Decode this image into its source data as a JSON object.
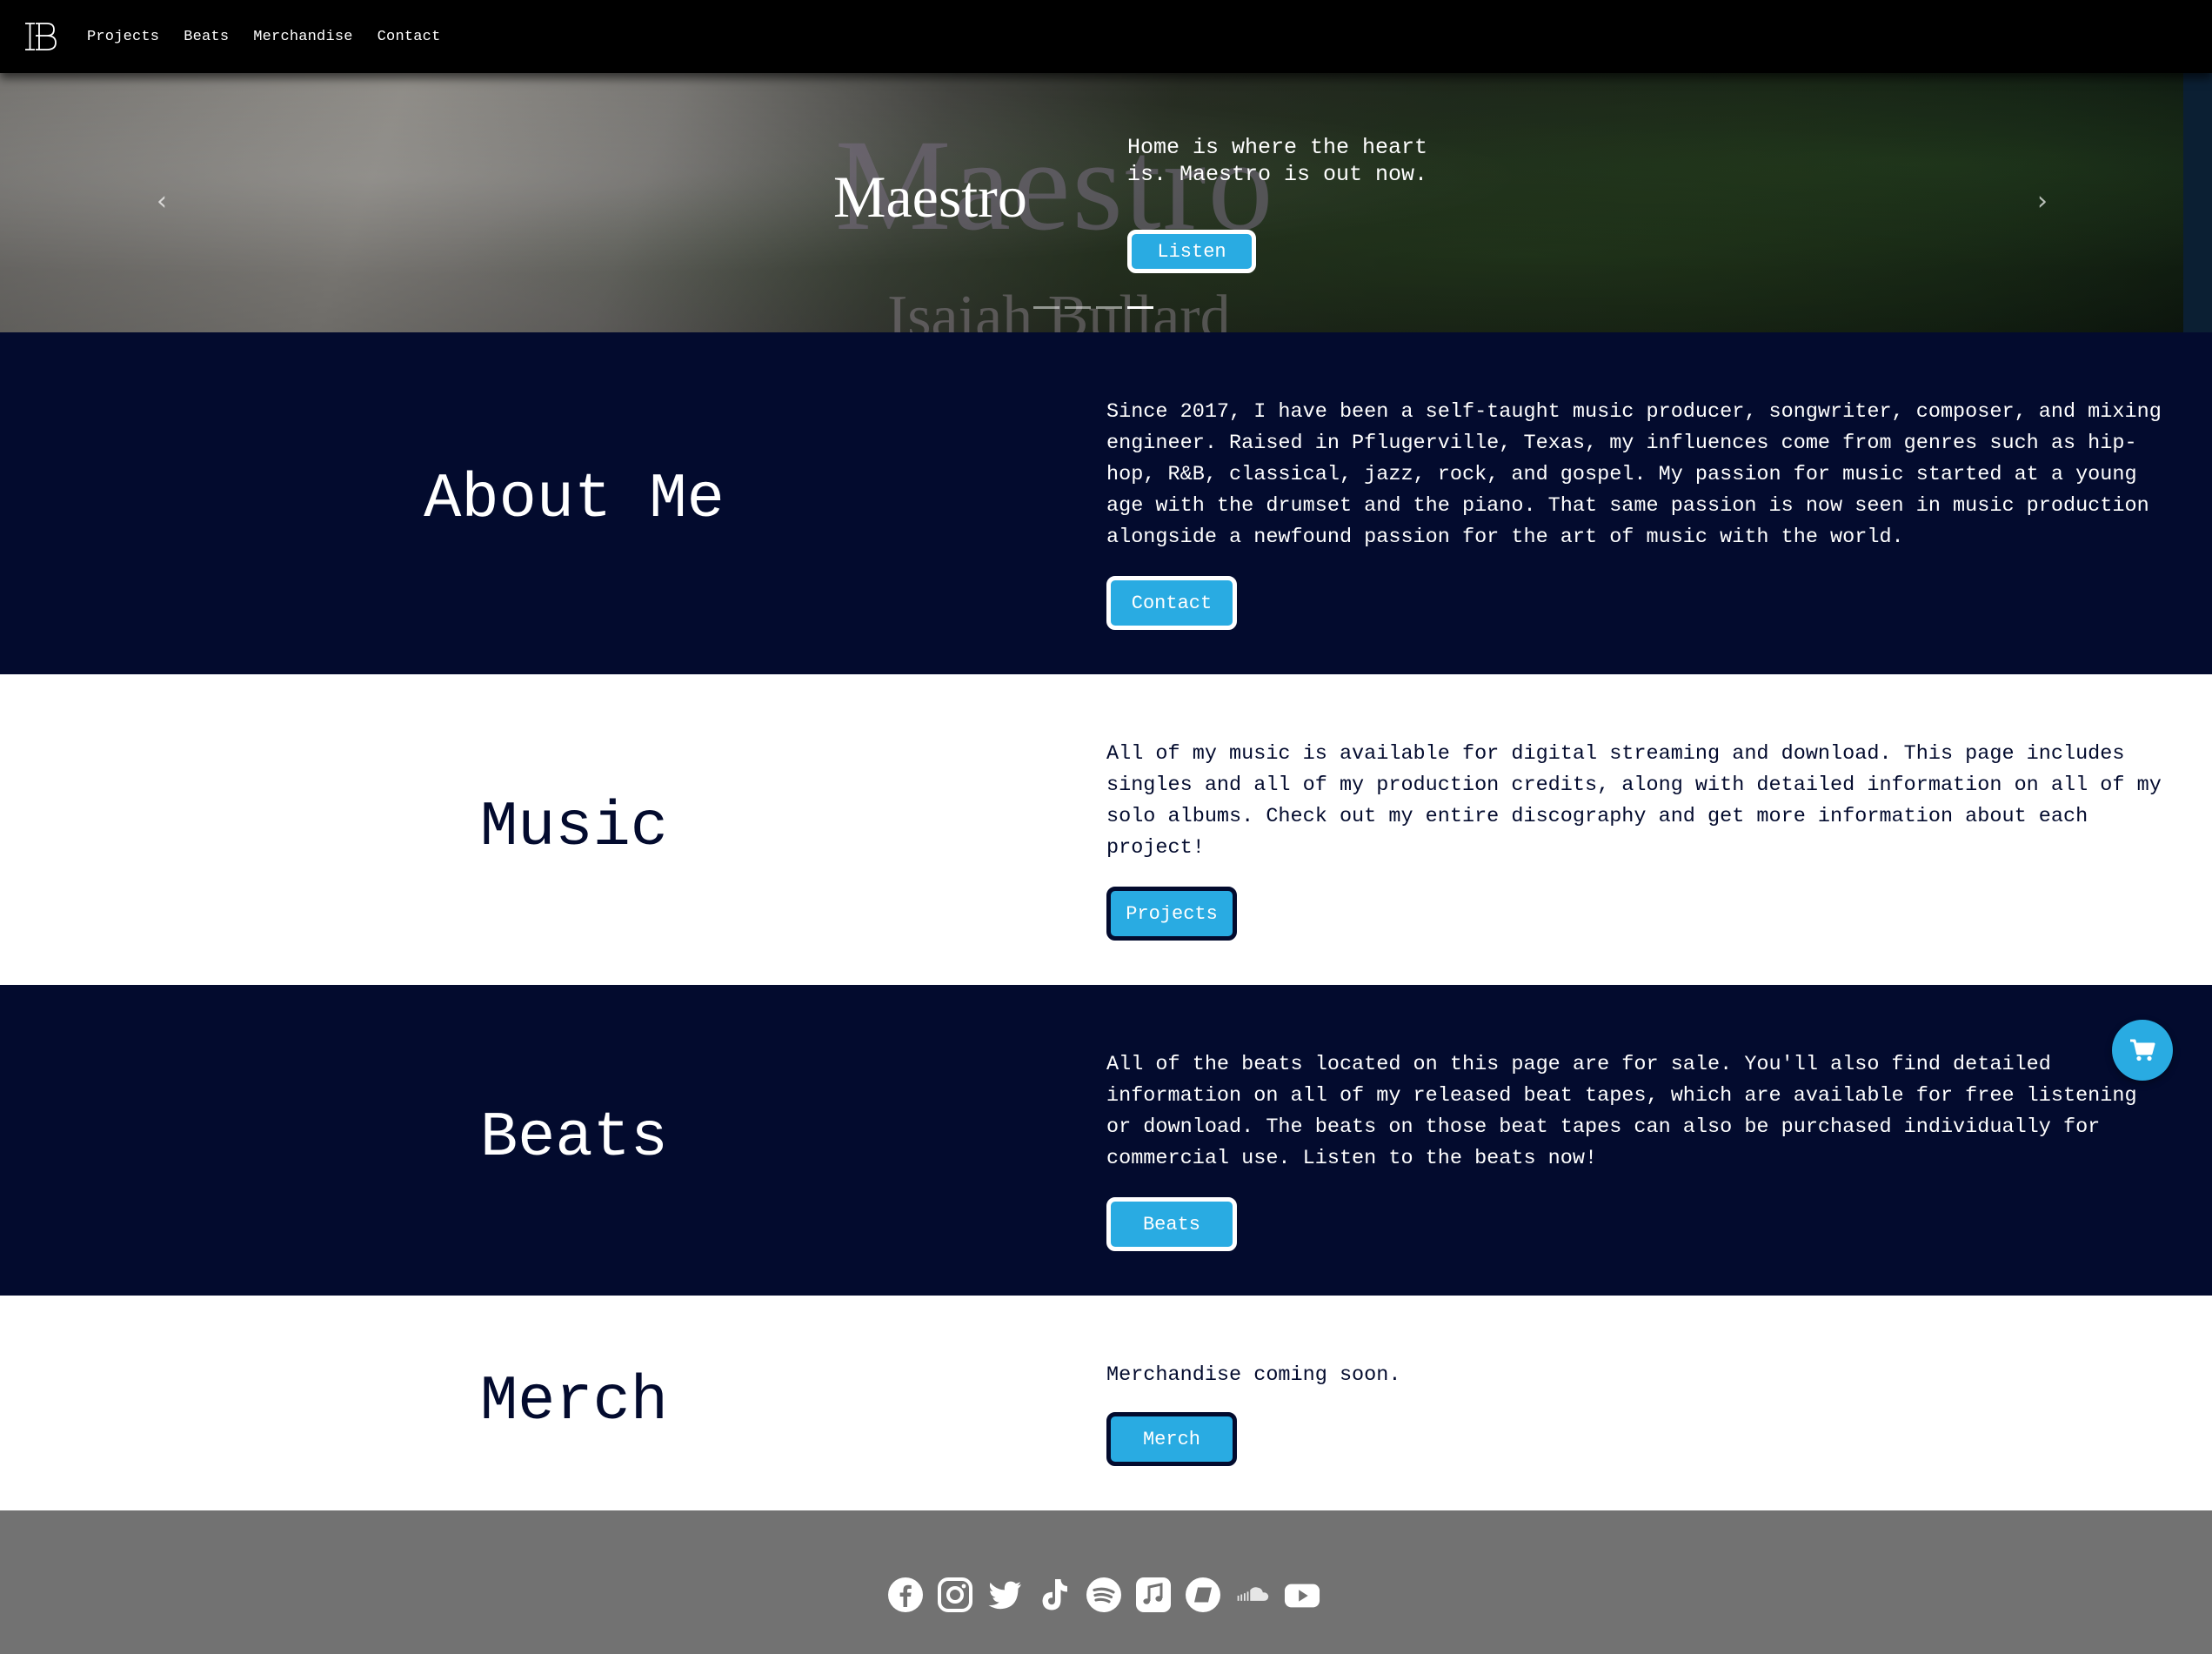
{
  "nav": {
    "logo_text": "IB",
    "links": [
      "Projects",
      "Beats",
      "Merchandise",
      "Contact"
    ]
  },
  "hero": {
    "background_title": "Maestro",
    "background_subtitle": "Isaiah Bullard",
    "title": "Maestro",
    "text": "Home is where the heart is. Maestro is out now.",
    "button": "Listen",
    "slide_count": 4,
    "active_slide": 4
  },
  "sections": {
    "about": {
      "heading": "About Me",
      "text": "Since 2017, I have been a self-taught music producer, songwriter, composer, and mixing engineer. Raised in Pflugerville, Texas, my influences come from genres such as hip-hop, R&B, classical, jazz, rock, and gospel. My passion for music started at a young age with the drumset and the piano. That same passion is now seen in music production alongside a newfound passion for the art of music with the world.",
      "button": "Contact"
    },
    "music": {
      "heading": "Music",
      "text": "All of my music is available for digital streaming and download. This page includes singles and all of my production credits, along with detailed information on all of my solo albums. Check out my entire discography and get more information about each project!",
      "button": "Projects"
    },
    "beats": {
      "heading": "Beats",
      "text": "All of the beats located on this page are for sale. You'll also find detailed information on all of my released beat tapes, which are available for free listening or download. The beats on those beat tapes can also be purchased individually for commercial use. Listen to the beats now!",
      "button": "Beats"
    },
    "merch": {
      "heading": "Merch",
      "text": "Merchandise coming soon.",
      "button": "Merch"
    }
  },
  "footer": {
    "social_icons": [
      "facebook-icon",
      "instagram-icon",
      "twitter-icon",
      "tiktok-icon",
      "spotify-icon",
      "apple-music-icon",
      "bandcamp-icon",
      "soundcloud-icon",
      "youtube-icon"
    ]
  },
  "cart": {
    "icon": "shopping-cart-icon"
  },
  "colors": {
    "navy": "#030b2e",
    "accent": "#29abe2",
    "footer": "#727272",
    "nav": "#000000"
  }
}
